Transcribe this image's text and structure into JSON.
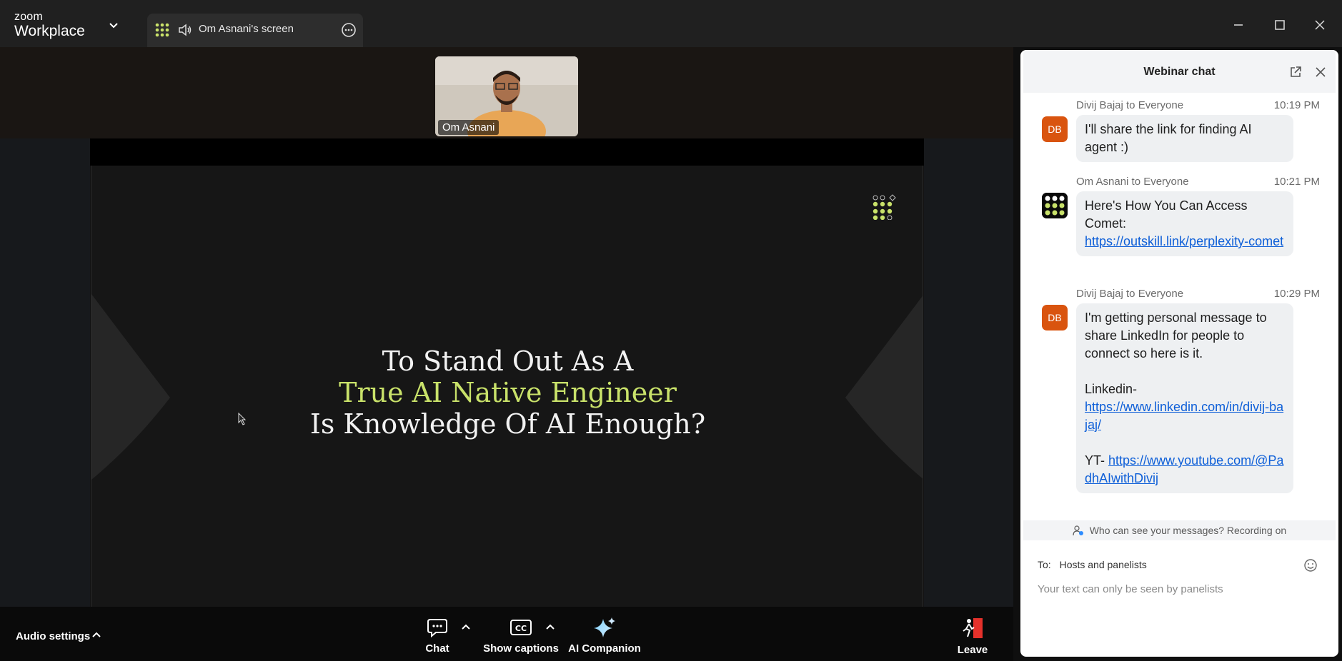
{
  "titlebar": {
    "brand_top": "zoom",
    "brand_bottom": "Workplace",
    "tab_title": "Om Asnani's screen"
  },
  "thumbnail": {
    "name": "Om Asnani"
  },
  "slide": {
    "line1": "To Stand Out As A",
    "line2": "True AI Native Engineer",
    "line3": "Is Knowledge Of AI Enough?",
    "accent_color": "#c9e26a"
  },
  "controls": {
    "audio_settings": "Audio settings",
    "chat": "Chat",
    "captions": "Show captions",
    "companion": "AI Companion",
    "leave": "Leave"
  },
  "chat": {
    "title": "Webinar chat",
    "messages": [
      {
        "avatar": "DB",
        "sender": "Divij Bajaj to Everyone",
        "time": "10:19 PM",
        "text1": "I'll share the link for finding AI agent :)"
      },
      {
        "avatar": "",
        "sender": "Om Asnani to Everyone",
        "time": "10:21 PM",
        "text1": "Here's How You Can Access Comet:",
        "link": "https://outskill.link/perplexity-comet"
      },
      {
        "avatar": "DB",
        "sender": "Divij Bajaj to Everyone",
        "time": "10:29 PM",
        "text1": "I'm getting personal message to share LinkedIn for people to connect so here is it.",
        "linkedin_label": "Linkedin-",
        "linkedin_link": "https://www.linkedin.com/in/divij-bajaj/",
        "yt_label": "YT-",
        "yt_link": "https://www.youtube.com/@PadhAIwithDivij"
      }
    ],
    "privacy": "Who can see your messages? Recording on",
    "to_label": "To:",
    "to_value": "Hosts and panelists",
    "input_placeholder": "Your text can only be seen by panelists"
  }
}
